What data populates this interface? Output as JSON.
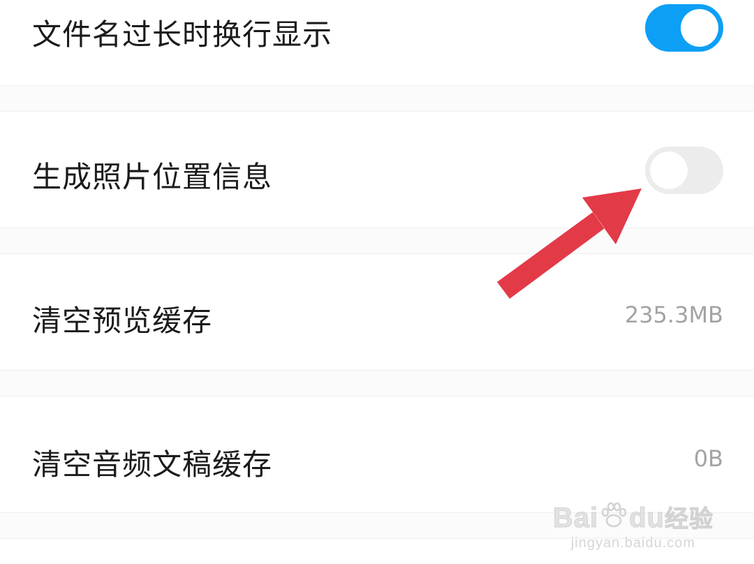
{
  "settings": {
    "items": [
      {
        "label": "文件名过长时换行显示",
        "type": "toggle",
        "enabled": true
      },
      {
        "label": "生成照片位置信息",
        "type": "toggle",
        "enabled": false
      },
      {
        "label": "清空预览缓存",
        "type": "value",
        "value": "235.3MB"
      },
      {
        "label": "清空音频文稿缓存",
        "type": "value",
        "value": "0B"
      }
    ]
  },
  "colors": {
    "toggle_on": "#0d9ff5",
    "toggle_off": "#ececec",
    "annotation_arrow": "#e33a48"
  },
  "annotation": {
    "icon": "arrow-icon"
  },
  "watermark": {
    "brand": "Bai",
    "brand_suffix": "du",
    "brand_cn": "经验",
    "url": "jingyan.baidu.com"
  }
}
